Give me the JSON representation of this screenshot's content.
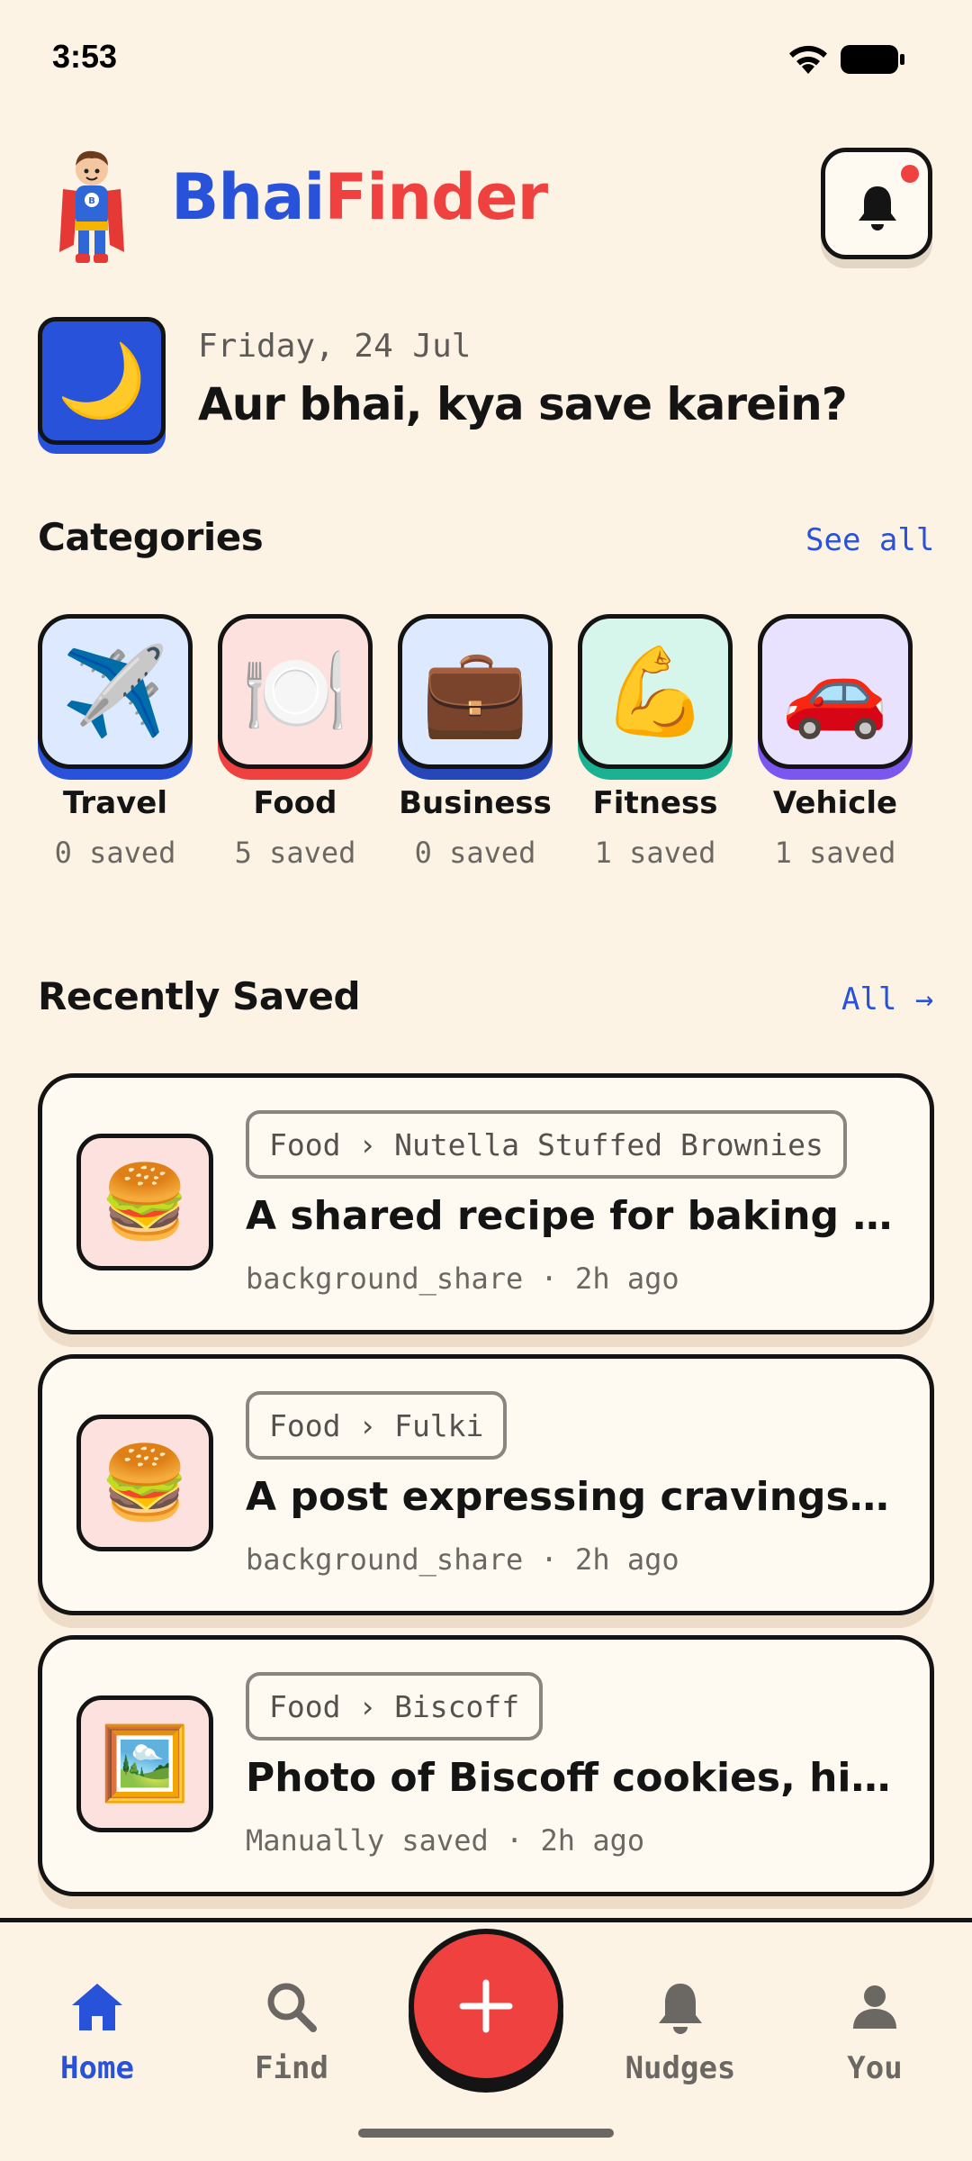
{
  "status": {
    "time": "3:53"
  },
  "header": {
    "brand_part1": "Bhai",
    "brand_part2": "Finder"
  },
  "greeting": {
    "date": "Friday, 24 Jul",
    "title": "Aur bhai, kya save karein?"
  },
  "categories": {
    "title": "Categories",
    "see_all": "See all",
    "items": [
      {
        "label": "Travel",
        "count": "0 saved",
        "emoji": "✈️",
        "bg": "#dce9ff",
        "accent": "#2752d9"
      },
      {
        "label": "Food",
        "count": "5 saved",
        "emoji": "🍽️",
        "bg": "#fde1de",
        "accent": "#ef4240"
      },
      {
        "label": "Business",
        "count": "0 saved",
        "emoji": "💼",
        "bg": "#dce9ff",
        "accent": "#2547b8"
      },
      {
        "label": "Fitness",
        "count": "1 saved",
        "emoji": "💪",
        "bg": "#d6f6ec",
        "accent": "#1bb191"
      },
      {
        "label": "Vehicle",
        "count": "1 saved",
        "emoji": "🚗",
        "bg": "#e9e2ff",
        "accent": "#7b57f0"
      }
    ]
  },
  "recent": {
    "title": "Recently Saved",
    "all_link": "All →",
    "items": [
      {
        "crumb": "Food › Nutella Stuffed Brownies",
        "title": "A shared recipe for baking Nutella Stuffed Brownies",
        "meta": "background_share · 2h ago",
        "emoji": "🍔"
      },
      {
        "crumb": "Food › Fulki",
        "title": "A post expressing cravings for Fulki",
        "meta": "background_share · 2h ago",
        "emoji": "🍔"
      },
      {
        "crumb": "Food › Biscoff",
        "title": "Photo of Biscoff cookies, highlighted",
        "meta": "Manually saved · 2h ago",
        "emoji": "🖼️"
      }
    ]
  },
  "nav": {
    "home": "Home",
    "find": "Find",
    "nudges": "Nudges",
    "you": "You"
  },
  "colors": {
    "accent_blue": "#2752d9",
    "accent_red": "#ef4240",
    "background": "#fdf3e4"
  }
}
